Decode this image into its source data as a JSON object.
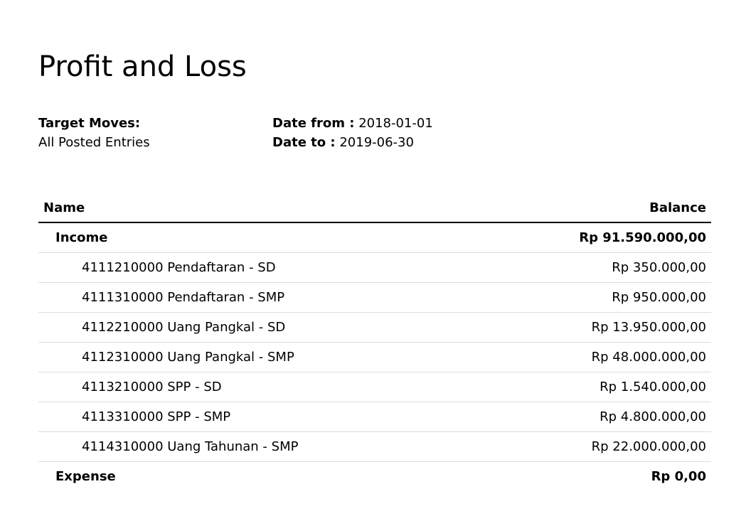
{
  "report": {
    "title": "Profit and Loss"
  },
  "filters": {
    "target_moves_label": "Target Moves:",
    "target_moves_value": "All Posted Entries",
    "date_from_label": "Date from :",
    "date_from_value": " 2018-01-01",
    "date_to_label": "Date to :",
    "date_to_value": " 2019-06-30"
  },
  "table": {
    "columns": {
      "name": "Name",
      "balance": "Balance"
    },
    "rows": [
      {
        "name": "Income",
        "balance": "Rp 91.590.000,00"
      },
      {
        "name": "4111210000 Pendaftaran - SD",
        "balance": "Rp 350.000,00"
      },
      {
        "name": "4111310000 Pendaftaran - SMP",
        "balance": "Rp 950.000,00"
      },
      {
        "name": "4112210000 Uang Pangkal - SD",
        "balance": "Rp 13.950.000,00"
      },
      {
        "name": "4112310000 Uang Pangkal - SMP",
        "balance": "Rp 48.000.000,00"
      },
      {
        "name": "4113210000 SPP - SD",
        "balance": "Rp 1.540.000,00"
      },
      {
        "name": "4113310000 SPP - SMP",
        "balance": "Rp 4.800.000,00"
      },
      {
        "name": "4114310000 Uang Tahunan - SMP",
        "balance": "Rp 22.000.000,00"
      },
      {
        "name": "Expense",
        "balance": "Rp 0,00"
      }
    ]
  }
}
